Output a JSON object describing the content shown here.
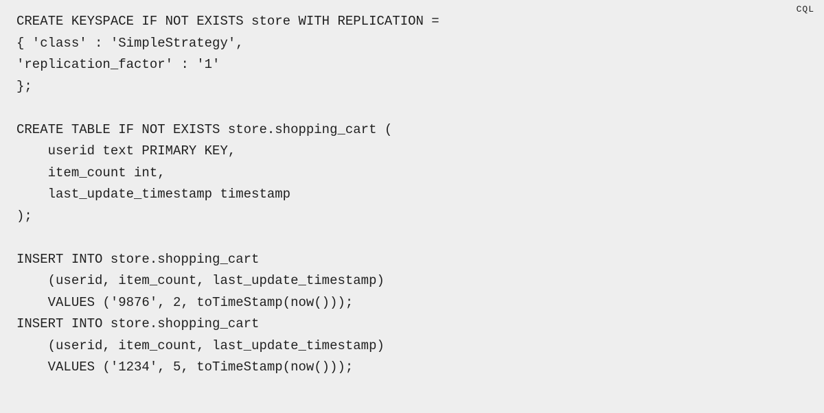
{
  "language_label": "CQL",
  "code_lines": [
    "CREATE KEYSPACE IF NOT EXISTS store WITH REPLICATION =",
    "{ 'class' : 'SimpleStrategy',",
    "'replication_factor' : '1'",
    "};",
    "",
    "CREATE TABLE IF NOT EXISTS store.shopping_cart (",
    "    userid text PRIMARY KEY,",
    "    item_count int,",
    "    last_update_timestamp timestamp",
    ");",
    "",
    "INSERT INTO store.shopping_cart",
    "    (userid, item_count, last_update_timestamp)",
    "    VALUES ('9876', 2, toTimeStamp(now()));",
    "INSERT INTO store.shopping_cart",
    "    (userid, item_count, last_update_timestamp)",
    "    VALUES ('1234', 5, toTimeStamp(now()));"
  ]
}
